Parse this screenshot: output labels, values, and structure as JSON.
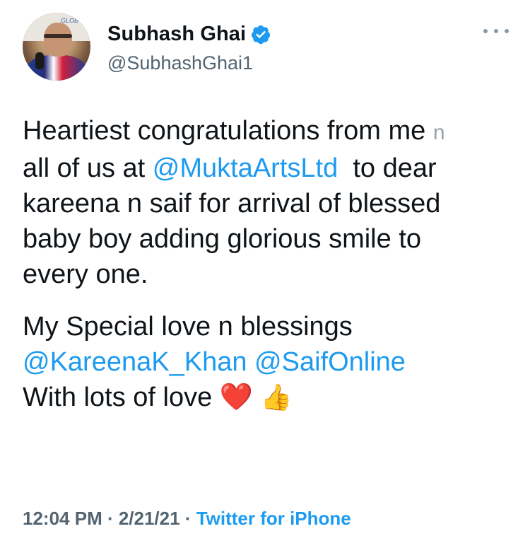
{
  "user": {
    "name": "Subhash Ghai",
    "handle": "@SubhashGhai1",
    "avatar_icon": "profile-photo",
    "verified_icon": "verified-badge-icon"
  },
  "tweet": {
    "line1_text": "Heartiest congratulations from me ",
    "line1_n": "n",
    "line2_pre": "all of us at ",
    "line2_mention": "@MuktaArtsLtd",
    "line2_post": "  to dear",
    "line3": "kareena n saif for arrival of blessed",
    "line4": "baby boy adding glorious smile to",
    "line5": "every one.",
    "para2_line1": "My Special love n blessings",
    "para2_mention1": "@KareenaK_Khan",
    "para2_mention2": "@SaifOnline",
    "para2_line3": "With lots of love ",
    "heart_emoji": "❤️",
    "thumb_emoji": "👍"
  },
  "meta": {
    "time": "12:04 PM · 2/21/21 · ",
    "source": "Twitter for iPhone"
  },
  "colors": {
    "accent": "#1d9bf0",
    "text": "#0f1419",
    "muted": "#536471"
  }
}
